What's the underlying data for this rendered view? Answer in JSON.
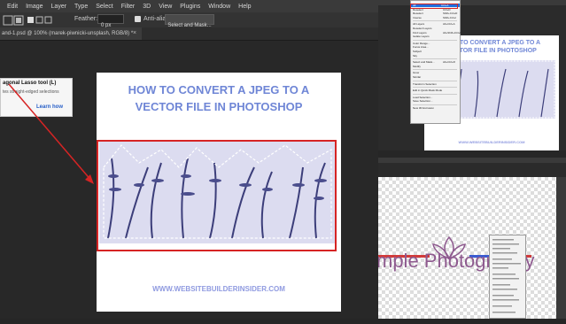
{
  "menu": [
    "Edit",
    "Image",
    "Layer",
    "Type",
    "Select",
    "Filter",
    "3D",
    "View",
    "Plugins",
    "Window",
    "Help"
  ],
  "options": {
    "feather_label": "Feather:",
    "feather_value": "0 px",
    "antialias_label": "Anti-alias",
    "select_mask_label": "Select and Mask..."
  },
  "document_tab": "and-1.psd @ 100% (marek-piwnicki-unsplash, RGB/8) *",
  "tooltip": {
    "title": "agonal Lasso tool (L)",
    "desc": "tes straight-edged selections",
    "link": "Learn how"
  },
  "artwork": {
    "title_line1": "HOW TO CONVERT A JPEG TO A",
    "title_line2": "VECTOR FILE IN PHOTOSHOP",
    "url": "WWW.WEBSITEBUILDERINSIDER.COM"
  },
  "right_top": {
    "title_line1": "HOW TO CONVERT A JPEG TO A",
    "title_line2": "VECTOR FILE IN PHOTOSHOP",
    "url": "WWW.WEBSITEBUILDERINSIDER.COM",
    "select_menu": [
      {
        "label": "All",
        "shortcut": "Ctrl+A",
        "highlight": true
      },
      {
        "label": "Deselect",
        "shortcut": "Ctrl+D"
      },
      {
        "label": "Reselect",
        "shortcut": "Shift+Ctrl+D"
      },
      {
        "label": "Inverse",
        "shortcut": "Shift+Ctrl+I"
      },
      {
        "sep": true
      },
      {
        "label": "All Layers",
        "shortcut": "Alt+Ctrl+A"
      },
      {
        "label": "Deselect Layers"
      },
      {
        "label": "Find Layers",
        "shortcut": "Alt+Shift+Ctrl+F"
      },
      {
        "label": "Isolate Layers"
      },
      {
        "sep": true
      },
      {
        "label": "Color Range..."
      },
      {
        "label": "Focus Area..."
      },
      {
        "label": "Subject"
      },
      {
        "label": "Sky"
      },
      {
        "sep": true
      },
      {
        "label": "Select and Mask...",
        "shortcut": "Alt+Ctrl+R"
      },
      {
        "label": "Modify"
      },
      {
        "sep": true
      },
      {
        "label": "Grow"
      },
      {
        "label": "Similar"
      },
      {
        "sep": true
      },
      {
        "label": "Transform Selection"
      },
      {
        "sep": true
      },
      {
        "label": "Edit in Quick Mask Mode"
      },
      {
        "sep": true
      },
      {
        "label": "Load Selection..."
      },
      {
        "label": "Save Selection..."
      },
      {
        "sep": true
      },
      {
        "label": "New 3D Extrusion"
      }
    ]
  },
  "right_bottom": {
    "text": "mple Photography"
  },
  "colors": {
    "accent_red": "#d62424",
    "title_blue": "#6f86d6",
    "menu_highlight": "#1f6fe0"
  }
}
